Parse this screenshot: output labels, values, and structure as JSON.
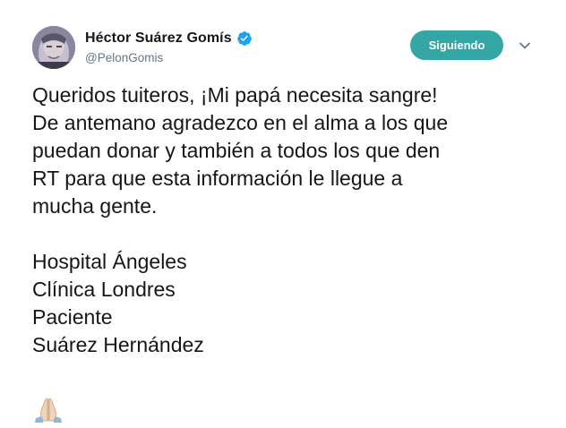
{
  "user": {
    "display_name": "Héctor Suárez Gomís",
    "handle": "@PelonGomis",
    "verified": true
  },
  "follow_button": {
    "label": "Siguiendo",
    "color": "#35a6a6"
  },
  "menu_icon": "chevron-down-icon",
  "tweet": {
    "paragraph1": [
      "Queridos tuiteros, ¡Mi papá necesita sangre!",
      "De antemano agradezco en el alma a los que",
      "puedan donar y también a todos los que den",
      "RT para que esta información le llegue a",
      "mucha gente."
    ],
    "paragraph2": [
      "Hospital Ángeles",
      "Clínica Londres",
      "Paciente",
      "Suárez Hernández"
    ],
    "emoji": "folded-hands-emoji"
  },
  "colors": {
    "text": "#14171a",
    "secondary": "#657786",
    "verified": "#1da1f2"
  }
}
